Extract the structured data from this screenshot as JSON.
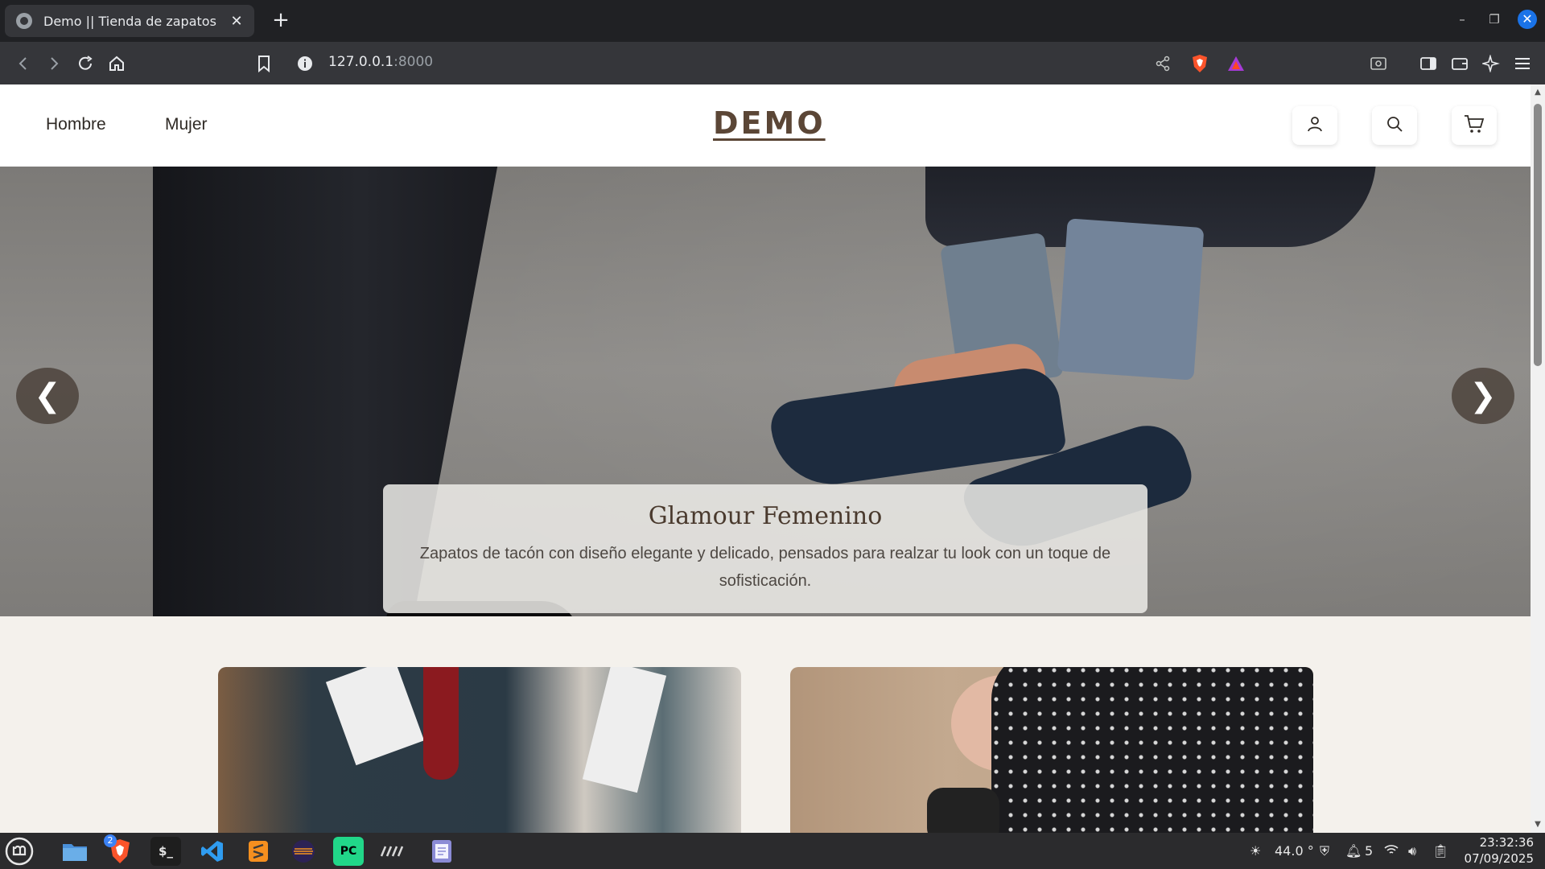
{
  "browser": {
    "tab": {
      "title": "Demo || Tienda de zapatos",
      "close": "✕"
    },
    "new_tab": "+",
    "url": {
      "host": "127.0.0.1",
      "port": ":8000"
    },
    "window": {
      "minimize": "–",
      "restore": "❐",
      "close": "✕"
    },
    "accent": "#1a73e8"
  },
  "site": {
    "nav": [
      {
        "label": "Hombre"
      },
      {
        "label": "Mujer"
      }
    ],
    "logo": "DEMO",
    "header_buttons": [
      "user-icon",
      "search-icon",
      "cart-icon"
    ],
    "brand_color": "#5b4636"
  },
  "hero": {
    "prev": "❮",
    "next": "❯",
    "title": "Glamour Femenino",
    "text": "Zapatos de tacón con diseño elegante y delicado, pensados para realzar tu look con un toque de sofisticación."
  },
  "taskbar": {
    "badge": "2",
    "terminal_label": "$_",
    "pycharm_label": "PC",
    "temperature": "44.0 °",
    "notifications": "5",
    "time": "23:32:36",
    "date": "07/09/2025"
  }
}
